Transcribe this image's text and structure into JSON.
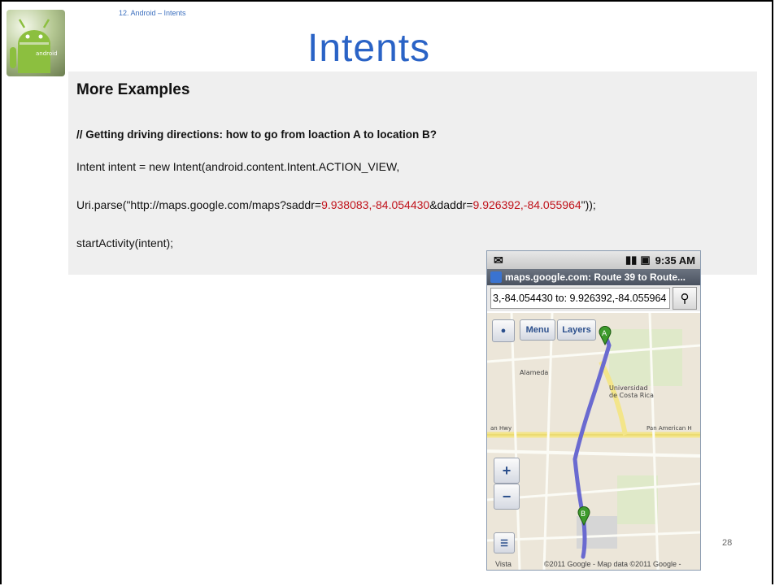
{
  "slide": {
    "breadcrumb": "12. Android – Intents",
    "title": "Intents",
    "heading": "More Examples",
    "comment": "// Getting driving directions: how to go from loaction A to location B?",
    "code_line1": "Intent intent = new Intent(android.content.Intent.ACTION_VIEW,",
    "code_line2_prefix": "Uri.parse(\"http://maps.google.com/maps?saddr=",
    "code_line2_saddr": "9.938083,-84.054430",
    "code_line2_mid": "&daddr=",
    "code_line2_daddr": "9.926392,-84.055964",
    "code_line2_suffix": "\"));",
    "code_line3": "startActivity(intent);",
    "page_number": "28"
  },
  "phone": {
    "status_time": "9:35 AM",
    "url_title": "maps.google.com: Route 39 to Route...",
    "search_value": "3,-84.054430 to: 9.926392,-84.055964",
    "menu_label": "Menu",
    "layers_label": "Layers",
    "zoom_in": "+",
    "zoom_out": "−",
    "vista": "Vista",
    "copyright": "©2011 Google - Map data ©2011 Google -"
  },
  "colors": {
    "title": "#2a63c6",
    "highlight": "#c0121a",
    "panel": "#efefef",
    "route": "#6a6ad0"
  }
}
